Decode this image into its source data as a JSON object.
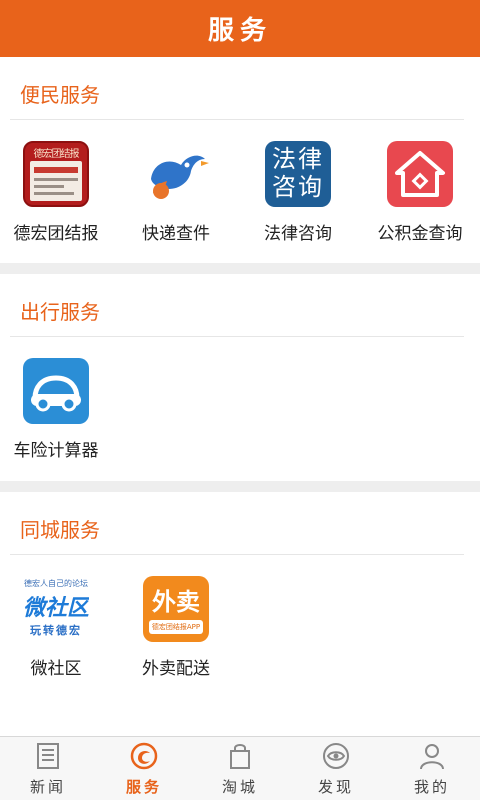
{
  "header": {
    "title": "服务"
  },
  "sections": [
    {
      "title": "便民服务",
      "items": [
        {
          "label": "德宏团结报",
          "icon": "newspaper-icon",
          "masthead": "德宏团结报",
          "headline": "全面政协十二届"
        },
        {
          "label": "快递查件",
          "icon": "bird-courier-icon"
        },
        {
          "label": "法律咨询",
          "icon": "law-consult-icon",
          "glyphs": "法律咨询"
        },
        {
          "label": "公积金查询",
          "icon": "housing-fund-icon"
        }
      ]
    },
    {
      "title": "出行服务",
      "items": [
        {
          "label": "车险计算器",
          "icon": "car-icon"
        }
      ]
    },
    {
      "title": "同城服务",
      "items": [
        {
          "label": "微社区",
          "icon": "micro-community-icon",
          "art_top": "德宏人自己的论坛",
          "art_main": "微社区",
          "art_bottom": "玩转德宏"
        },
        {
          "label": "外卖配送",
          "icon": "takeout-icon",
          "art_main": "外卖",
          "art_strip": "德宏团结报APP"
        }
      ]
    }
  ],
  "tabbar": {
    "active": "服务",
    "tabs": [
      {
        "label": "新闻",
        "icon": "news-icon"
      },
      {
        "label": "服务",
        "icon": "service-icon"
      },
      {
        "label": "淘城",
        "icon": "shopping-bag-icon"
      },
      {
        "label": "发现",
        "icon": "discover-eye-icon"
      },
      {
        "label": "我的",
        "icon": "profile-icon"
      }
    ]
  },
  "colors": {
    "accent": "#E8631B",
    "section_gap": "#EEEEEE"
  }
}
